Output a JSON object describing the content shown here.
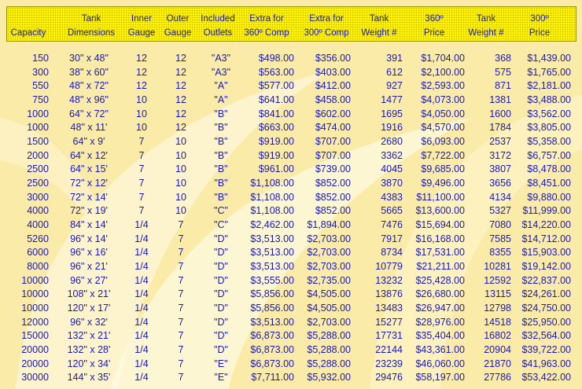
{
  "headers": [
    [
      "",
      "Capacity"
    ],
    [
      "Tank",
      "Dimensions"
    ],
    [
      "Inner",
      "Gauge"
    ],
    [
      "Outer",
      "Gauge"
    ],
    [
      "Included",
      "Outlets"
    ],
    [
      "Extra for",
      "360º Comp"
    ],
    [
      "Extra for",
      "300º Comp"
    ],
    [
      "Tank",
      "Weight #"
    ],
    [
      "360º",
      "Price"
    ],
    [
      "Tank",
      "Weight #"
    ],
    [
      "300º",
      "Price"
    ]
  ],
  "rows": [
    [
      "150",
      "30\" x 48\"",
      "12",
      "12",
      "\"A3\"",
      "$498.00",
      "$356.00",
      "391",
      "$1,704.00",
      "368",
      "$1,439.00"
    ],
    [
      "300",
      "38\" x 60\"",
      "12",
      "12",
      "\"A3\"",
      "$563.00",
      "$403.00",
      "612",
      "$2,100.00",
      "575",
      "$1,765.00"
    ],
    [
      "550",
      "48\" x 72\"",
      "12",
      "12",
      "\"A\"",
      "$577.00",
      "$412.00",
      "927",
      "$2,593.00",
      "871",
      "$2,181.00"
    ],
    [
      "750",
      "48\" x 96\"",
      "10",
      "12",
      "\"A\"",
      "$641.00",
      "$458.00",
      "1477",
      "$4,073.00",
      "1381",
      "$3,488.00"
    ],
    [
      "1000",
      "64\" x 72\"",
      "10",
      "12",
      "\"B\"",
      "$841.00",
      "$602.00",
      "1695",
      "$4,050.00",
      "1600",
      "$3,562.00"
    ],
    [
      "1000",
      "48\" x 11'",
      "10",
      "12",
      "\"B\"",
      "$663.00",
      "$474.00",
      "1916",
      "$4,570.00",
      "1784",
      "$3,805.00"
    ],
    [
      "1500",
      "64\" x  9'",
      "7",
      "10",
      "\"B\"",
      "$919.00",
      "$707.00",
      "2680",
      "$6,093.00",
      "2537",
      "$5,358.00"
    ],
    [
      "2000",
      "64\" x 12'",
      "7",
      "10",
      "\"B\"",
      "$919.00",
      "$707.00",
      "3362",
      "$7,722.00",
      "3172",
      "$6,757.00"
    ],
    [
      "2500",
      "64\" x 15'",
      "7",
      "10",
      "\"B\"",
      "$961.00",
      "$739.00",
      "4045",
      "$9,685.00",
      "3807",
      "$8,478.00"
    ],
    [
      "2500",
      "72\" x 12'",
      "7",
      "10",
      "\"B\"",
      "$1,108.00",
      "$852.00",
      "3870",
      "$9,496.00",
      "3656",
      "$8,451.00"
    ],
    [
      "3000",
      "72\" x 14'",
      "7",
      "10",
      "\"B\"",
      "$1,108.00",
      "$852.00",
      "4383",
      "$11,100.00",
      "4134",
      "$9,880.00"
    ],
    [
      "4000",
      "72\" x 19'",
      "7",
      "10",
      "\"C\"",
      "$1,108.00",
      "$852.00",
      "5665",
      "$13,600.00",
      "5327",
      "$11,999.00"
    ],
    [
      "4000",
      "84\" x 14'",
      "1/4",
      "7",
      "\"C\"",
      "$2,462.00",
      "$1,894.00",
      "7476",
      "$15,694.00",
      "7080",
      "$14,220.00"
    ],
    [
      "5260",
      "96\" x 14'",
      "1/4",
      "7",
      "\"D\"",
      "$3,513.00",
      "$2,703.00",
      "7917",
      "$16,168.00",
      "7585",
      "$14,712.00"
    ],
    [
      "6000",
      "96\" x 16'",
      "1/4",
      "7",
      "\"D\"",
      "$3,513.00",
      "$2,703.00",
      "8734",
      "$17,531.00",
      "8355",
      "$15,903.00"
    ],
    [
      "8000",
      "96\" x 21'",
      "1/4",
      "7",
      "\"D\"",
      "$3,513.00",
      "$2,703.00",
      "10779",
      "$21,211.00",
      "10281",
      "$19,142.00"
    ],
    [
      "10000",
      "96\" x 27'",
      "1/4",
      "7",
      "\"D\"",
      "$3,555.00",
      "$2,735.00",
      "13232",
      "$25,428.00",
      "12592",
      "$22,837.00"
    ],
    [
      "10000",
      "108\" x 21'",
      "1/4",
      "7",
      "\"D\"",
      "$5,856.00",
      "$4,505.00",
      "13876",
      "$26,680.00",
      "13115",
      "$24,261.00"
    ],
    [
      "10000",
      "120\" x 17'",
      "1/4",
      "7",
      "\"D\"",
      "$5,856.00",
      "$4,505.00",
      "13483",
      "$26,947.00",
      "12798",
      "$24,750.00"
    ],
    [
      "12000",
      "96\" x 32'",
      "1/4",
      "7",
      "\"D\"",
      "$3,513.00",
      "$2,703.00",
      "15277",
      "$28,976.00",
      "14518",
      "$25,950.00"
    ],
    [
      "15000",
      "132\" x 21'",
      "1/4",
      "7",
      "\"D\"",
      "$6,873.00",
      "$5,288.00",
      "17731",
      "$35,404.00",
      "16802",
      "$32,564.00"
    ],
    [
      "20000",
      "132\" x 28'",
      "1/4",
      "7",
      "\"D\"",
      "$6,873.00",
      "$5,288.00",
      "22144",
      "$43,361.00",
      "20904",
      "$39,722.00"
    ],
    [
      "20000",
      "120\" x 34'",
      "1/4",
      "7",
      "\"E\"",
      "$6,873.00",
      "$5,288.00",
      "23239",
      "$46,060.00",
      "21870",
      "$41,963.00"
    ],
    [
      "30000",
      "144\" x 35'",
      "1/4",
      "7",
      "\"E\"",
      "$7,711.00",
      "$5,932.00",
      "29476",
      "$58,197.00",
      "27786",
      "$53,422.00"
    ]
  ],
  "colors": {
    "text": "#1a1ab4",
    "background": "#fbeba8",
    "header": "#fff200"
  }
}
